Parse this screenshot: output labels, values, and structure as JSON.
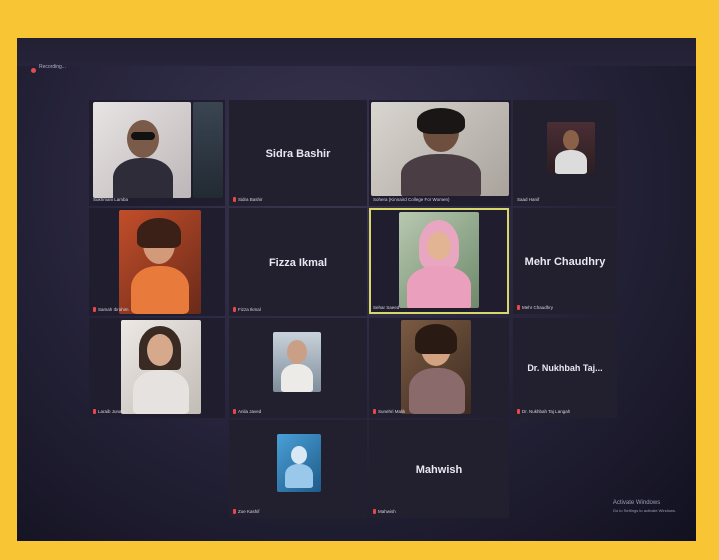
{
  "meeting": {
    "recording_label": "Recording..."
  },
  "participants": [
    {
      "name": "Sukhmani Lamba",
      "label": "Sukhmani Lamba",
      "mode": "video",
      "muted": false
    },
    {
      "name": "Sidra Bashir",
      "label": "Sidra Bashir",
      "mode": "name",
      "muted": true
    },
    {
      "name": "Sohera (Kinnaird College For Women)",
      "label": "Sohera (Kinnaird College For Women)",
      "mode": "video",
      "muted": false
    },
    {
      "name": "Saad Hanif",
      "label": "Saad Hanif",
      "mode": "video",
      "muted": false
    },
    {
      "name": "Samah Ibrahim",
      "label": "Samah Ibrahim",
      "mode": "video",
      "muted": true
    },
    {
      "name": "Fizza Ikmal",
      "label": "Fizza Ikmal",
      "mode": "name",
      "muted": true
    },
    {
      "name": "Sehar Saeed",
      "label": "Sehar Saeed",
      "mode": "video",
      "muted": false,
      "active": true
    },
    {
      "name": "Mehr Chaudhry",
      "label": "Mehr Chaudhry",
      "mode": "name",
      "muted": true
    },
    {
      "name": "Laraib Junaid",
      "label": "Laraib Junaid",
      "mode": "video",
      "muted": true
    },
    {
      "name": "Anila Javed",
      "label": "Anila Javed",
      "mode": "video",
      "muted": true
    },
    {
      "name": "Sunehri Malik",
      "label": "Sunehri Malik",
      "mode": "video",
      "muted": true
    },
    {
      "name": "Dr. Nukhbah Taj...",
      "label": "Dr. Nukhbah Taj Langah",
      "mode": "name",
      "muted": true
    },
    {
      "name": "Zoe Kashif",
      "label": "Zoe Kashif",
      "mode": "video",
      "muted": true
    },
    {
      "name": "Mahwish",
      "label": "Mahwish",
      "mode": "name",
      "muted": true
    }
  ],
  "windows_watermark": {
    "title": "Activate Windows",
    "subtitle": "Go to Settings to activate Windows."
  },
  "colors": {
    "frame": "#f8c534",
    "muted_mic": "#e54848",
    "active_speaker_border": "#d8d86a"
  }
}
